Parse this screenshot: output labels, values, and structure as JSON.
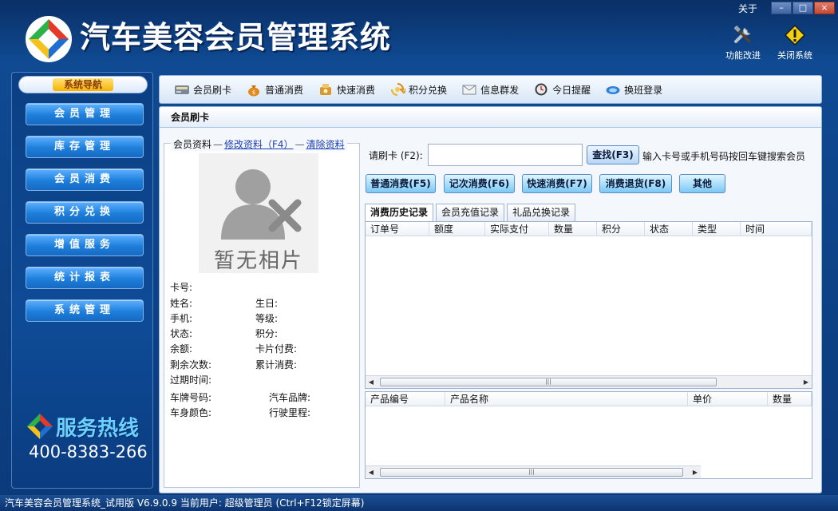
{
  "window": {
    "about_label": "关于",
    "minimize_symbol": "–",
    "maximize_symbol": "□",
    "close_symbol": "×"
  },
  "header": {
    "app_title": "汽车美容会员管理系统",
    "logo_icon": "four-color-diamond-logo",
    "tools": [
      {
        "label": "功能改进",
        "icon": "tools-icon"
      },
      {
        "label": "关闭系统",
        "icon": "warning-icon"
      }
    ]
  },
  "nav": {
    "header_label": "系统导航",
    "items": [
      {
        "label": "会员管理"
      },
      {
        "label": "库存管理"
      },
      {
        "label": "会员消费"
      },
      {
        "label": "积分兑换"
      },
      {
        "label": "增值服务"
      },
      {
        "label": "统计报表"
      },
      {
        "label": "系统管理"
      }
    ],
    "hotline_title": "服务热线",
    "hotline_number": "400-8383-266"
  },
  "toolbar": {
    "items": [
      {
        "label": "会员刷卡",
        "icon": "card-reader-icon"
      },
      {
        "label": "普通消费",
        "icon": "money-bag-icon"
      },
      {
        "label": "快速消费",
        "icon": "quick-pay-icon"
      },
      {
        "label": "积分兑换",
        "icon": "exchange-icon"
      },
      {
        "label": "信息群发",
        "icon": "envelope-icon"
      },
      {
        "label": "今日提醒",
        "icon": "clock-icon"
      },
      {
        "label": "换班登录",
        "icon": "handshake-icon"
      }
    ]
  },
  "panel": {
    "title": "会员刷卡",
    "member_info": {
      "legend_label": "会员资料",
      "edit_link": "修改资料（F4）",
      "clear_link": "清除资料",
      "photo_placeholder": "暂无相片",
      "fields": {
        "card_no": "卡号:",
        "name": "姓名:",
        "birthday": "生日:",
        "phone": "手机:",
        "level": "等级:",
        "status": "状态:",
        "points": "积分:",
        "balance": "余额:",
        "card_fee": "卡片付费:",
        "remaining_times": "剩余次数:",
        "total_spent": "累计消费:",
        "expire_time": "过期时间:",
        "plate_no": "车牌号码:",
        "car_brand": "汽车品牌:",
        "car_color": "车身颜色:",
        "mileage": "行驶里程:"
      }
    },
    "card_search": {
      "label": "请刷卡 (F2):",
      "value": "",
      "search_button": "查找(F3)",
      "hint": "输入卡号或手机号码按回车键搜索会员"
    },
    "actions": [
      {
        "label": "普通消费(F5)"
      },
      {
        "label": "记次消费(F6)"
      },
      {
        "label": "快速消费(F7)"
      },
      {
        "label": "消费退货(F8)"
      },
      {
        "label": "其他"
      }
    ],
    "tabs": [
      {
        "label": "消费历史记录",
        "active": true
      },
      {
        "label": "会员充值记录",
        "active": false
      },
      {
        "label": "礼品兑换记录",
        "active": false
      }
    ],
    "history_columns": [
      "订单号",
      "额度",
      "实际支付",
      "数量",
      "积分",
      "状态",
      "类型",
      "时间"
    ],
    "detail_columns": [
      "产品编号",
      "产品名称",
      "单价",
      "数量"
    ]
  },
  "statusbar": {
    "text": "汽车美容会员管理系统_试用版 V6.9.0.9 当前用户: 超级管理员 (Ctrl+F12锁定屏幕)"
  }
}
